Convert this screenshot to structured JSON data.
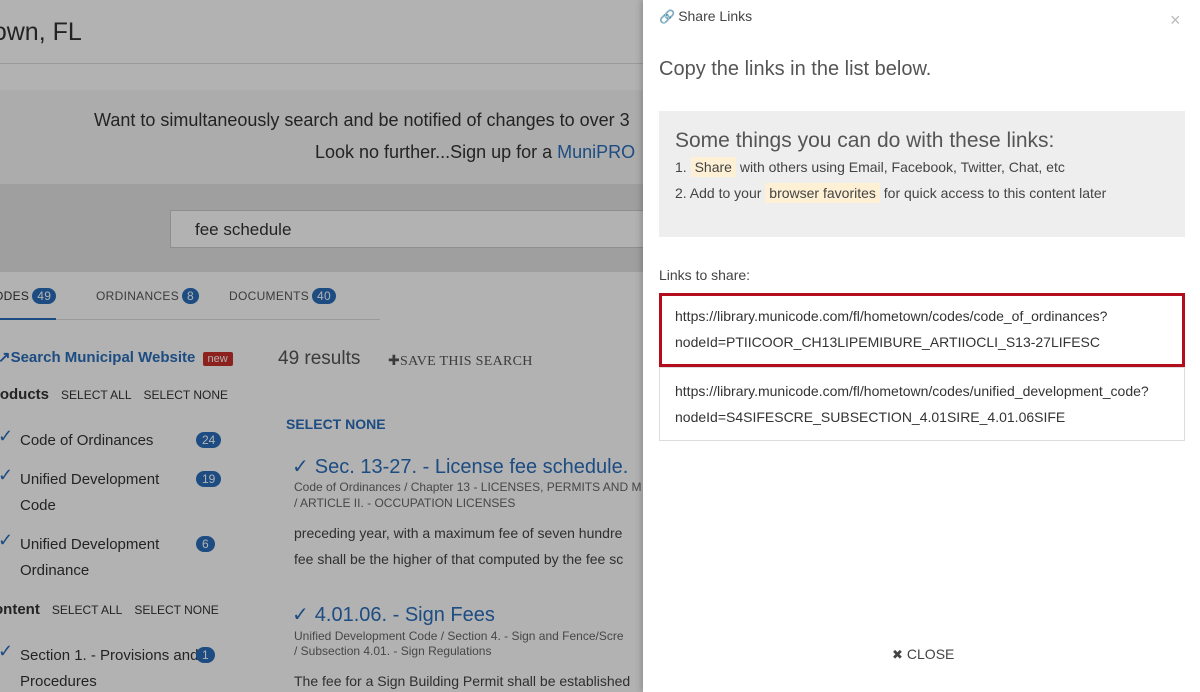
{
  "background": {
    "title": "etown, FL",
    "promo": {
      "line1": "Want to simultaneously search and be notified of changes to over 3",
      "line2_prefix": "Look no further...Sign up for a ",
      "line2_link": "MuniPRO"
    },
    "search_value": "fee schedule",
    "tabs": [
      {
        "label": "ODES",
        "count": "49"
      },
      {
        "label": "ORDINANCES",
        "count": "8"
      },
      {
        "label": "DOCUMENTS",
        "count": "40"
      }
    ],
    "sidebar": {
      "municipal_link": "Search Municipal Website",
      "new_badge": "new",
      "products_heading": "roducts",
      "content_heading": "ontent",
      "select_all": "SELECT ALL",
      "select_none": "SELECT NONE",
      "products": [
        {
          "line1": "Code of Ordinances",
          "line2": "",
          "count": "24"
        },
        {
          "line1": "Unified Development",
          "line2": "Code",
          "count": "19"
        },
        {
          "line1": "Unified Development",
          "line2": "Ordinance",
          "count": "6"
        }
      ],
      "content": [
        {
          "line1": "Section 1. - Provisions and",
          "line2": "Procedures",
          "count": "1"
        }
      ]
    },
    "results": {
      "count_text": "49 results",
      "save_search": "SAVE THIS SEARCH",
      "select_none": "SELECT NONE",
      "items": [
        {
          "title": "Sec. 13-27. - License fee schedule.",
          "crumb1": "Code of Ordinances  /  Chapter 13 - LICENSES, PERMITS AND M",
          "crumb2": "/  ARTICLE II. - OCCUPATION LICENSES",
          "snippet1": "preceding year, with a maximum fee of seven hundre",
          "snippet2": "fee shall be the higher of that computed by the fee sc"
        },
        {
          "title": "4.01.06. - Sign Fees",
          "crumb1": "Unified Development Code  /  Section 4. - Sign and Fence/Scre",
          "crumb2": "/  Subsection 4.01. - Sign Regulations",
          "snippet1": "The fee for a Sign Building Permit shall be established"
        }
      ]
    }
  },
  "panel": {
    "header": "Share Links",
    "subtitle": "Copy the links in the list below.",
    "tips": {
      "heading": "Some things you can do with these links:",
      "tip1_prefix": "1.",
      "tip1_highlight": "Share",
      "tip1_rest": "with others using Email, Facebook, Twitter, Chat, etc",
      "tip2_prefix": "2. Add to your",
      "tip2_highlight": "browser favorites",
      "tip2_rest": "for quick access to this content later"
    },
    "links_label": "Links to share:",
    "links": [
      {
        "line1": "https://library.municode.com/fl/hometown/codes/code_of_ordinances?",
        "line2": "nodeId=PTIICOOR_CH13LIPEMIBURE_ARTIIOCLI_S13-27LIFESC"
      },
      {
        "line1": "https://library.municode.com/fl/hometown/codes/unified_development_code?",
        "line2": "nodeId=S4SIFESCRE_SUBSECTION_4.01SIRE_4.01.06SIFE"
      }
    ],
    "close_label": "CLOSE"
  },
  "colors": {
    "accent": "#2a6ebb",
    "selected_border": "#b30d1d",
    "badge_new": "#c9302c"
  }
}
